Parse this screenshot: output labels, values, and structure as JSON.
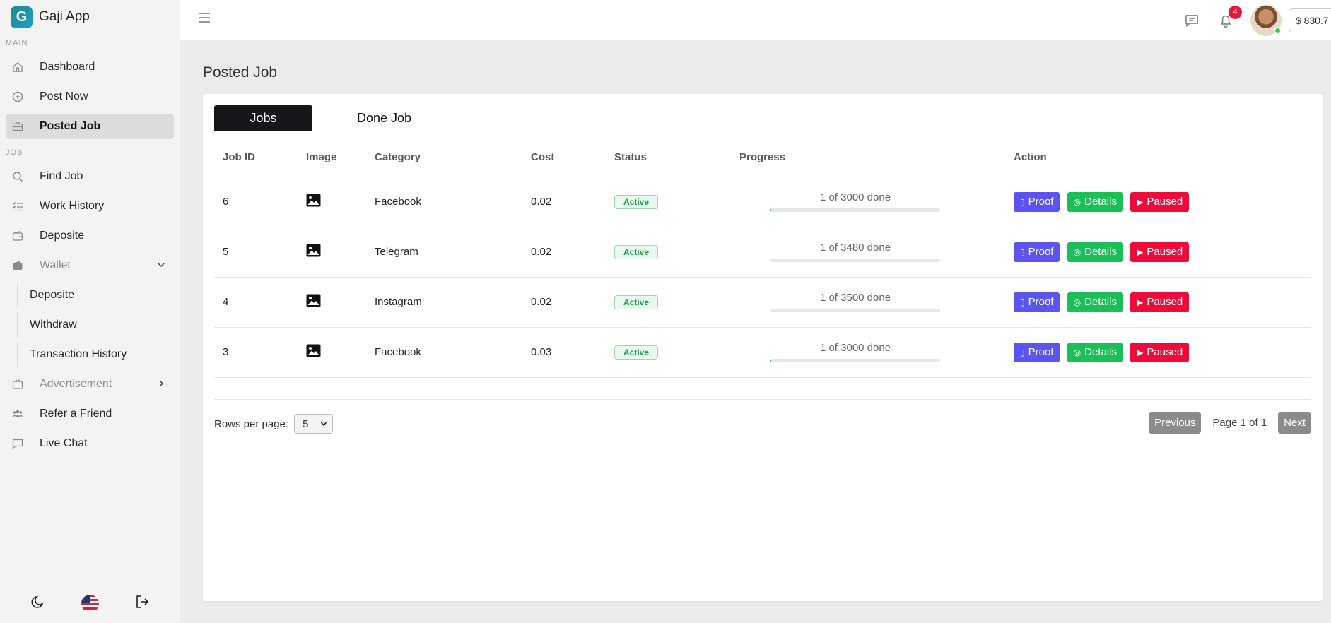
{
  "app": {
    "logo_letter": "G",
    "name": "Gaji App"
  },
  "sidebar": {
    "section_main": "MAIN",
    "section_job": "JOB",
    "items": [
      {
        "label": "Dashboard",
        "icon": "home-icon"
      },
      {
        "label": "Post Now",
        "icon": "plus-circle-icon"
      },
      {
        "label": "Posted Job",
        "icon": "briefcase-icon"
      },
      {
        "label": "Find Job",
        "icon": "search-icon"
      },
      {
        "label": "Work History",
        "icon": "list-check-icon"
      },
      {
        "label": "Deposite",
        "icon": "wallet-icon"
      },
      {
        "label": "Wallet",
        "icon": "wallet-filled-icon"
      },
      {
        "label": "Advertisement",
        "icon": "tv-icon"
      },
      {
        "label": "Refer a Friend",
        "icon": "users-icon"
      },
      {
        "label": "Live Chat",
        "icon": "chat-icon"
      }
    ],
    "wallet_sub": [
      "Deposite",
      "Withdraw",
      "Transaction History"
    ]
  },
  "topbar": {
    "notifications_count": "4",
    "balance": "$ 830.7"
  },
  "page": {
    "title": "Posted Job"
  },
  "tabs": [
    {
      "label": "Jobs"
    },
    {
      "label": "Done Job"
    }
  ],
  "table": {
    "headers": [
      "Job ID",
      "Image",
      "Category",
      "Cost",
      "Status",
      "Progress",
      "Action"
    ],
    "rows": [
      {
        "id": "6",
        "category": "Facebook",
        "cost": "0.02",
        "status": "Active",
        "progress_text": "1 of 3000 done",
        "progress": 0.00033
      },
      {
        "id": "5",
        "category": "Telegram",
        "cost": "0.02",
        "status": "Active",
        "progress_text": "1 of 3480 done",
        "progress": 0.00029
      },
      {
        "id": "4",
        "category": "Instagram",
        "cost": "0.02",
        "status": "Active",
        "progress_text": "1 of 3500 done",
        "progress": 0.00029
      },
      {
        "id": "3",
        "category": "Facebook",
        "cost": "0.03",
        "status": "Active",
        "progress_text": "1 of 3000 done",
        "progress": 0.00033
      }
    ],
    "actions": {
      "proof": "Proof",
      "details": "Details",
      "paused": "Paused"
    }
  },
  "pagination": {
    "rows_label": "Rows per page:",
    "rows_value": "5",
    "previous": "Previous",
    "info": "Page 1 of 1",
    "next": "Next"
  },
  "colors": {
    "proof": "#5b54f0",
    "details": "#1bbf57",
    "paused": "#ee0b3b",
    "active_tab": "#17171b"
  }
}
